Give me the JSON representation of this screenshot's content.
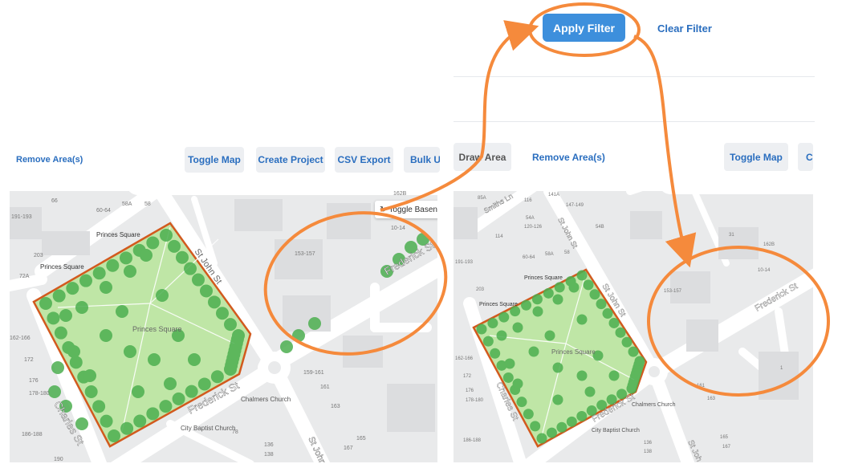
{
  "filter_bar": {
    "apply_label": "Apply Filter",
    "clear_label": "Clear Filter"
  },
  "left_panel": {
    "remove_area_label": "Remove Area(s)",
    "toggle_map_label": "Toggle Map",
    "create_project_label": "Create Project",
    "csv_export_label": "CSV Export",
    "bulk_label": "Bulk Up",
    "toggle_basemap_label": "Toggle Basen"
  },
  "right_panel": {
    "draw_area_label": "Draw Area",
    "remove_area_label": "Remove Area(s)",
    "toggle_map_label": "Toggle Map",
    "cut_label": "C"
  },
  "map_left": {
    "streets": [
      "St John St",
      "Charles St",
      "Frederick St",
      "Frederick St",
      "St John"
    ],
    "places": [
      "Princes Square",
      "Princes Square",
      "Princes Square",
      "Chalmers Church",
      "City Baptist Church"
    ],
    "addresses": [
      "66",
      "58A",
      "58",
      "60-64",
      "191-193",
      "203",
      "72A",
      "162-166",
      "172",
      "176",
      "178-180",
      "186-188",
      "190",
      "159-161",
      "161",
      "163",
      "165",
      "167",
      "136",
      "138",
      "78",
      "162B",
      "10-14",
      "153-157"
    ]
  },
  "map_right": {
    "streets": [
      "Smiths Ln",
      "St John St",
      "St John St",
      "Charles St",
      "Frederick St",
      "Frederick St",
      "St Joh"
    ],
    "places": [
      "Princes Square",
      "Princes Square",
      "Princes Square",
      "Chalmers Church",
      "City Baptist Church"
    ],
    "addresses": [
      "85A",
      "116",
      "141A",
      "147-149",
      "114",
      "120-126",
      "54A",
      "54B",
      "191-193",
      "60-64",
      "58A",
      "58",
      "203",
      "162-166",
      "172",
      "176",
      "178-180",
      "186-188",
      "153-157",
      "31",
      "162B",
      "10-14",
      "161",
      "163",
      "165",
      "167",
      "136",
      "138",
      "1"
    ]
  },
  "colors": {
    "accent_blue": "#3d8fdc",
    "annotation_orange": "#f58a3c",
    "tree_green": "#4caf50",
    "park_fill": "#bfe6a6",
    "boundary": "#d25a1e"
  }
}
